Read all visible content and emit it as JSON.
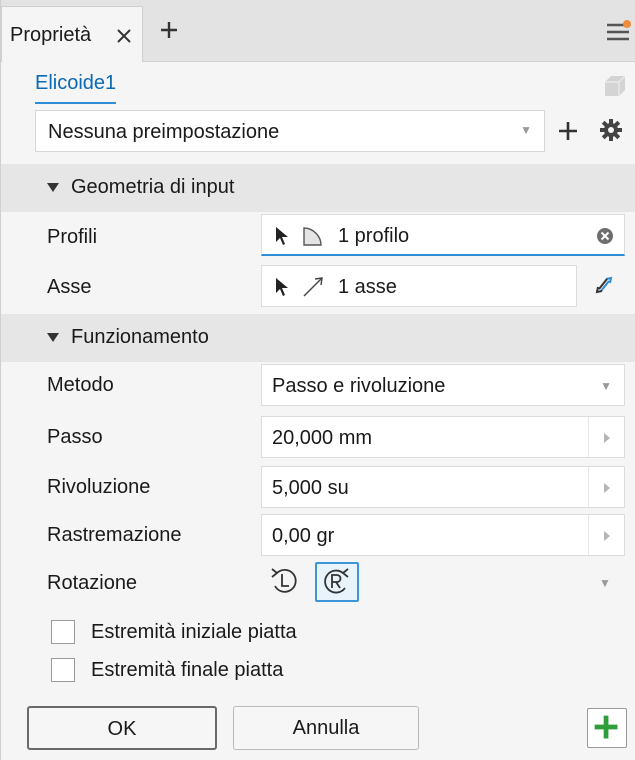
{
  "window": {
    "tab_label": "Proprietà"
  },
  "feature": {
    "name": "Elicoide1"
  },
  "preset": {
    "value": "Nessuna preimpostazione"
  },
  "sections": {
    "input": "Geometria di input",
    "behavior": "Funzionamento"
  },
  "input_geometry": {
    "profiles_label": "Profili",
    "profiles_value": "1 profilo",
    "axis_label": "Asse",
    "axis_value": "1 asse"
  },
  "behavior": {
    "method_label": "Metodo",
    "method_value": "Passo e rivoluzione",
    "pitch_label": "Passo",
    "pitch_value": "20,000 mm",
    "revolution_label": "Rivoluzione",
    "revolution_value": "5,000 su",
    "taper_label": "Rastremazione",
    "taper_value": "0,00 gr",
    "rotation_label": "Rotazione",
    "rotation_selected": "right-hand"
  },
  "options": {
    "flat_start_label": "Estremità iniziale piatta",
    "flat_start_checked": false,
    "flat_end_label": "Estremità finale piatta",
    "flat_end_checked": false
  },
  "buttons": {
    "ok": "OK",
    "cancel": "Annulla"
  },
  "colors": {
    "accent": "#2f8cd6",
    "notify": "#f08a3c",
    "add_green": "#2e9e3a"
  },
  "icons": [
    "close-icon",
    "add-tab-icon",
    "menu-icon",
    "cube-icon",
    "plus-icon",
    "gear-icon",
    "cursor-icon",
    "profile-shape-icon",
    "axis-line-icon",
    "clear-icon",
    "flip-icon",
    "rotate-left-icon",
    "rotate-right-icon",
    "green-plus-icon"
  ]
}
